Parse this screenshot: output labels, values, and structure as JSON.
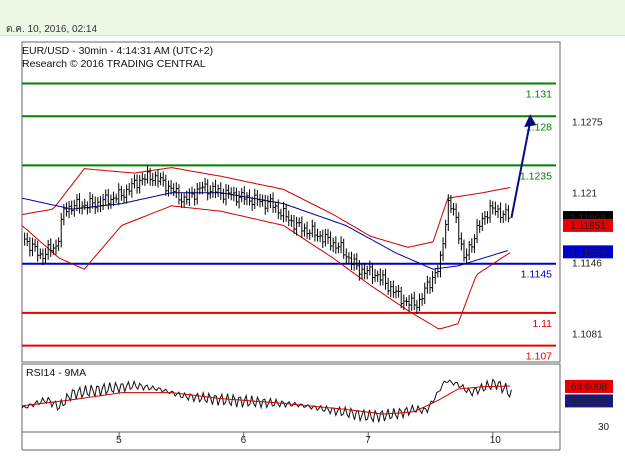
{
  "header": {
    "timestamp": "ต.ค. 10, 2016, 02:14",
    "line1": "EUR/USD - 30min - 4:14:31 AM (UTC+2)",
    "line2": "Research © 2016 TRADING CENTRAL"
  },
  "colors": {
    "resistance": "#008000",
    "support": "#e60000",
    "pivot": "#0000cc",
    "price": "#000000",
    "bollinger": "#cc0000",
    "ma": "#0000aa",
    "arrow": "#0a0a80",
    "panel_border": "#666666"
  },
  "chart_data": [
    {
      "type": "line",
      "panel": "price",
      "x_ticks": [
        {
          "label": "5",
          "x": 0.18
        },
        {
          "label": "6",
          "x": 1.18
        },
        {
          "label": "7",
          "x": 2.18
        },
        {
          "label": "10",
          "x": 3.18
        }
      ],
      "x_range": [
        -0.6,
        3.72
      ],
      "ylim": [
        1.1055,
        1.1348
      ],
      "y_ticks": [
        1.1275,
        1.121,
        1.1146,
        1.1081
      ],
      "levels": [
        {
          "label": "1.131",
          "value": 1.131,
          "role": "resistance"
        },
        {
          "label": "1.128",
          "value": 1.128,
          "role": "resistance"
        },
        {
          "label": "1.1235",
          "value": 1.1235,
          "role": "resistance"
        },
        {
          "label": "1.1145",
          "value": 1.1145,
          "role": "pivot"
        },
        {
          "label": "1.11",
          "value": 1.11,
          "role": "support"
        },
        {
          "label": "1.107",
          "value": 1.107,
          "role": "support"
        }
      ],
      "badges": [
        {
          "label": "1.11868",
          "value": 1.11868,
          "style": "black"
        },
        {
          "label": "1.11851",
          "value": 1.11851,
          "style": "red"
        },
        {
          "label": "1.11554",
          "value": 1.11554,
          "style": "blue"
        }
      ],
      "close_key": [
        [
          -0.6,
          1.117
        ],
        [
          -0.45,
          1.1152
        ],
        [
          -0.32,
          1.1162
        ],
        [
          -0.26,
          1.1195
        ],
        [
          -0.18,
          1.1198
        ],
        [
          0.0,
          1.12
        ],
        [
          0.2,
          1.1208
        ],
        [
          0.35,
          1.1222
        ],
        [
          0.45,
          1.1225
        ],
        [
          0.55,
          1.1218
        ],
        [
          0.7,
          1.1203
        ],
        [
          0.85,
          1.1215
        ],
        [
          1.0,
          1.121
        ],
        [
          1.2,
          1.1205
        ],
        [
          1.4,
          1.12
        ],
        [
          1.6,
          1.118
        ],
        [
          1.8,
          1.117
        ],
        [
          1.95,
          1.116
        ],
        [
          2.1,
          1.114
        ],
        [
          2.25,
          1.1135
        ],
        [
          2.4,
          1.1118
        ],
        [
          2.5,
          1.1108
        ],
        [
          2.6,
          1.111
        ],
        [
          2.65,
          1.1125
        ],
        [
          2.75,
          1.114
        ],
        [
          2.82,
          1.12
        ],
        [
          2.88,
          1.119
        ],
        [
          2.95,
          1.1148
        ],
        [
          3.05,
          1.1175
        ],
        [
          3.15,
          1.1195
        ],
        [
          3.25,
          1.1192
        ],
        [
          3.32,
          1.1187
        ]
      ],
      "ma_key": [
        [
          -0.6,
          1.1205
        ],
        [
          -0.2,
          1.1195
        ],
        [
          0.2,
          1.12
        ],
        [
          0.6,
          1.121
        ],
        [
          1.0,
          1.121
        ],
        [
          1.5,
          1.12
        ],
        [
          2.0,
          1.118
        ],
        [
          2.4,
          1.1155
        ],
        [
          2.7,
          1.114
        ],
        [
          2.9,
          1.1143
        ],
        [
          3.1,
          1.115
        ],
        [
          3.3,
          1.1157
        ]
      ],
      "bb_upper_key": [
        [
          -0.6,
          1.119
        ],
        [
          -0.35,
          1.1195
        ],
        [
          -0.1,
          1.1232
        ],
        [
          0.3,
          1.1228
        ],
        [
          0.6,
          1.1233
        ],
        [
          1.0,
          1.1225
        ],
        [
          1.5,
          1.1213
        ],
        [
          1.9,
          1.119
        ],
        [
          2.2,
          1.117
        ],
        [
          2.5,
          1.116
        ],
        [
          2.7,
          1.1165
        ],
        [
          2.82,
          1.1205
        ],
        [
          3.1,
          1.121
        ],
        [
          3.33,
          1.1215
        ]
      ],
      "bb_lower_key": [
        [
          -0.6,
          1.118
        ],
        [
          -0.3,
          1.115
        ],
        [
          -0.1,
          1.114
        ],
        [
          0.2,
          1.118
        ],
        [
          0.6,
          1.1198
        ],
        [
          1.0,
          1.1193
        ],
        [
          1.5,
          1.118
        ],
        [
          1.9,
          1.115
        ],
        [
          2.2,
          1.1125
        ],
        [
          2.5,
          1.1102
        ],
        [
          2.75,
          1.1085
        ],
        [
          2.9,
          1.109
        ],
        [
          3.05,
          1.1135
        ],
        [
          3.33,
          1.1156
        ]
      ],
      "forecast_arrow": {
        "from": [
          3.33,
          1.1187
        ],
        "to": [
          3.48,
          1.1282
        ]
      }
    },
    {
      "type": "line",
      "panel": "rsi",
      "title": "RSI14 - 9MA",
      "ylim": [
        25,
        82
      ],
      "y_ticks": [
        30
      ],
      "badges": [
        {
          "label": "63.6008",
          "value": 63.6008,
          "style": "red"
        },
        {
          "label": "54.8313",
          "value": 54.8313,
          "style": "navy"
        }
      ],
      "rsi_key": [
        [
          -0.6,
          45
        ],
        [
          -0.4,
          52
        ],
        [
          -0.3,
          46
        ],
        [
          -0.2,
          57
        ],
        [
          0.0,
          60
        ],
        [
          0.3,
          64
        ],
        [
          0.5,
          61
        ],
        [
          0.7,
          55
        ],
        [
          1.0,
          52
        ],
        [
          1.3,
          50
        ],
        [
          1.6,
          48
        ],
        [
          1.9,
          43
        ],
        [
          2.2,
          38
        ],
        [
          2.4,
          40
        ],
        [
          2.55,
          44
        ],
        [
          2.65,
          43
        ],
        [
          2.8,
          68
        ],
        [
          2.9,
          65
        ],
        [
          3.0,
          58
        ],
        [
          3.1,
          62
        ],
        [
          3.2,
          66
        ],
        [
          3.3,
          60
        ],
        [
          3.33,
          55
        ]
      ],
      "rsi_ma_key": [
        [
          -0.6,
          47
        ],
        [
          -0.2,
          52
        ],
        [
          0.2,
          58
        ],
        [
          0.6,
          58
        ],
        [
          1.0,
          53
        ],
        [
          1.5,
          49
        ],
        [
          2.0,
          44
        ],
        [
          2.3,
          40
        ],
        [
          2.55,
          42
        ],
        [
          2.75,
          52
        ],
        [
          2.9,
          61
        ],
        [
          3.1,
          63
        ],
        [
          3.33,
          63.6
        ]
      ]
    }
  ]
}
